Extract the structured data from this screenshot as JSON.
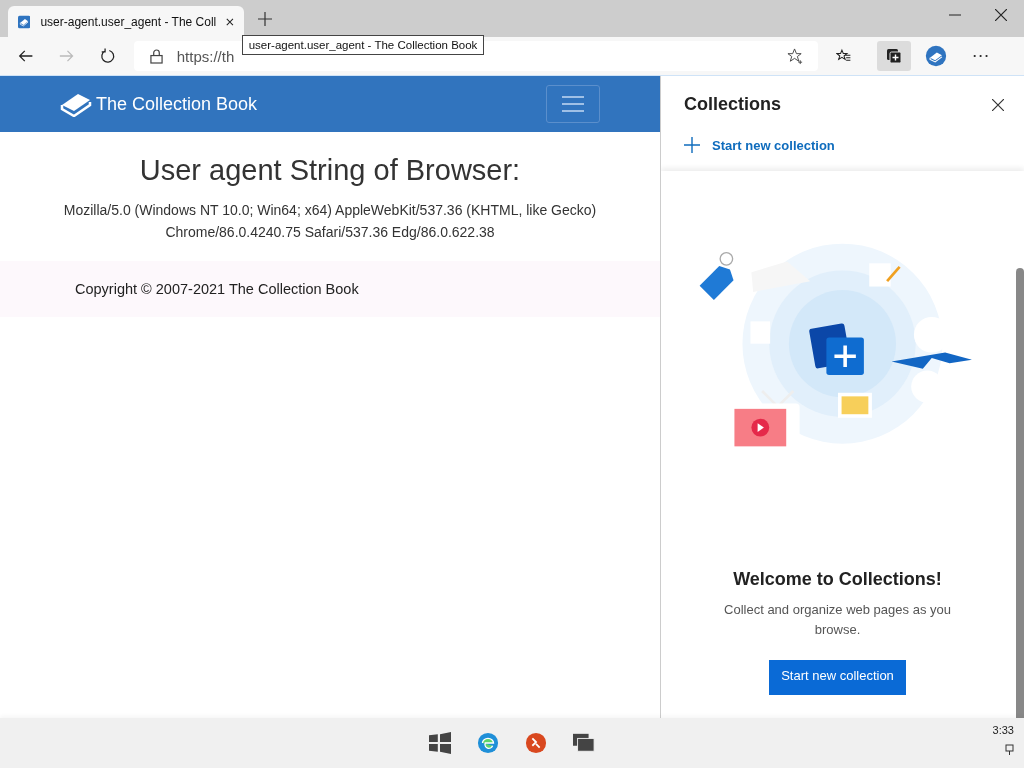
{
  "browser": {
    "tab": {
      "title": "user-agent.user_agent - The Coll",
      "selected": true
    },
    "address": {
      "url": "https://th"
    },
    "tooltip": "user-agent.user_agent - The Collection Book",
    "collections_active": true
  },
  "page": {
    "brand": "The Collection Book",
    "heading": "User agent String of Browser:",
    "user_agent": "Mozilla/5.0 (Windows NT 10.0; Win64; x64) AppleWebKit/537.36 (KHTML, like Gecko) Chrome/86.0.4240.75 Safari/537.36 Edg/86.0.622.38",
    "footer": "Copyright © 2007-2021 The Collection Book"
  },
  "collections_panel": {
    "title": "Collections",
    "new_link": "Start new collection",
    "welcome_title": "Welcome to Collections!",
    "welcome_text": "Collect and organize web pages as you browse.",
    "button": "Start new collection"
  },
  "taskbar": {
    "time": "3:33"
  }
}
